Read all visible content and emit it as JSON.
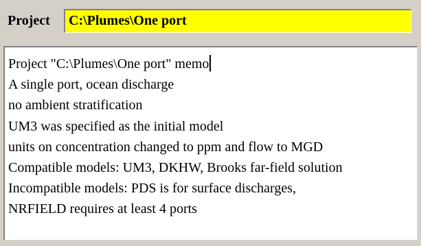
{
  "project": {
    "label": "Project",
    "path": "C:\\Plumes\\One port"
  },
  "memo": {
    "lines": [
      "Project \"C:\\Plumes\\One port\" memo",
      "A single port, ocean discharge",
      "no ambient stratification",
      "UM3 was specified as the initial model",
      "units on concentration changed to ppm and flow to MGD",
      "Compatible models: UM3, DKHW, Brooks far-field solution",
      "Incompatible models: PDS is for surface discharges,",
      "NRFIELD requires at least 4 ports"
    ]
  },
  "colors": {
    "project_field_bg": "#ffff00",
    "window_bg": "#d4d0c8"
  }
}
